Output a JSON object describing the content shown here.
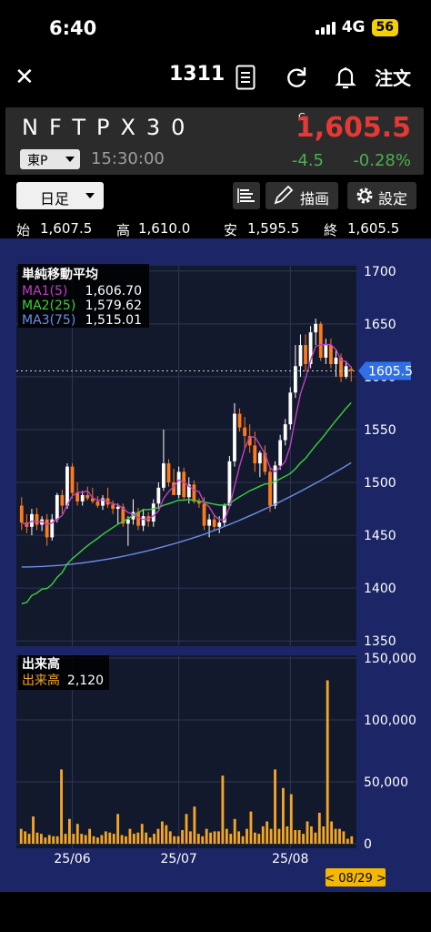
{
  "status_bar": {
    "time": "6:40",
    "network": "4G",
    "battery": "56"
  },
  "nav": {
    "stock_code": "1311",
    "order_label": "注文"
  },
  "quote": {
    "name": "NFTPX30",
    "realtime_marker": "C",
    "price": "1,605.5",
    "market": "東P",
    "time": "15:30:00",
    "change": "-4.5",
    "change_pct": "-0.28%"
  },
  "toolbar": {
    "period": "日足",
    "draw_label": "描画",
    "settings_label": "設定"
  },
  "ohlc": {
    "open_label": "始",
    "open": "1,607.5",
    "high_label": "高",
    "high": "1,610.0",
    "low_label": "安",
    "low": "1,595.5",
    "close_label": "終",
    "close": "1,605.5"
  },
  "colors": {
    "chart_bg": "#1c2565",
    "plot_bg": "#13192d",
    "up": "#ffffff",
    "down": "#ff7a1a",
    "ma1": "#c040c0",
    "ma2": "#3cd03c",
    "ma3": "#6c8ee6",
    "price_tag": "#2f6fe8",
    "volume": "#f5a623",
    "price_red": "#e53935",
    "change_green": "#4caf50"
  },
  "chart_data": {
    "type": "candlestick",
    "price_axis": {
      "ticks": [
        "1700",
        "1650",
        "1600",
        "1550",
        "1500",
        "1450",
        "1400",
        "1350"
      ],
      "min": 1345,
      "max": 1705
    },
    "volume_axis": {
      "ticks": [
        "150,000",
        "100,000",
        "50,000",
        "0"
      ],
      "max": 150000
    },
    "x_ticks": [
      "25/06",
      "25/07",
      "25/08"
    ],
    "x_tick_index": [
      10,
      31,
      53
    ],
    "last_price_tag": "1605.5",
    "date_tag": "< 08/29 >",
    "ma_legend": {
      "title": "単純移動平均",
      "items": [
        {
          "name": "MA1(5)",
          "value": "1,606.70"
        },
        {
          "name": "MA2(25)",
          "value": "1,579.62"
        },
        {
          "name": "MA3(75)",
          "value": "1,515.01"
        }
      ]
    },
    "volume_legend": {
      "title": "出来高",
      "name": "出来高",
      "value": "2,120"
    },
    "candles": [
      [
        1478,
        1486,
        1455,
        1462
      ],
      [
        1462,
        1470,
        1452,
        1458
      ],
      [
        1458,
        1475,
        1450,
        1470
      ],
      [
        1470,
        1476,
        1455,
        1460
      ],
      [
        1460,
        1468,
        1454,
        1465
      ],
      [
        1465,
        1470,
        1440,
        1448
      ],
      [
        1448,
        1470,
        1445,
        1465
      ],
      [
        1465,
        1490,
        1462,
        1488
      ],
      [
        1488,
        1493,
        1470,
        1478
      ],
      [
        1478,
        1518,
        1475,
        1515
      ],
      [
        1515,
        1518,
        1485,
        1490
      ],
      [
        1490,
        1500,
        1478,
        1482
      ],
      [
        1482,
        1492,
        1478,
        1488
      ],
      [
        1488,
        1496,
        1483,
        1485
      ],
      [
        1485,
        1495,
        1480,
        1482
      ],
      [
        1482,
        1487,
        1476,
        1478
      ],
      [
        1478,
        1488,
        1474,
        1485
      ],
      [
        1485,
        1495,
        1476,
        1479
      ],
      [
        1479,
        1483,
        1470,
        1475
      ],
      [
        1475,
        1480,
        1460,
        1477
      ],
      [
        1477,
        1480,
        1458,
        1461
      ],
      [
        1461,
        1468,
        1440,
        1465
      ],
      [
        1465,
        1484,
        1460,
        1472
      ],
      [
        1472,
        1476,
        1455,
        1459
      ],
      [
        1459,
        1475,
        1454,
        1468
      ],
      [
        1468,
        1472,
        1458,
        1463
      ],
      [
        1463,
        1484,
        1458,
        1480
      ],
      [
        1480,
        1500,
        1475,
        1495
      ],
      [
        1495,
        1550,
        1492,
        1518
      ],
      [
        1518,
        1522,
        1496,
        1500
      ],
      [
        1500,
        1513,
        1490,
        1488
      ],
      [
        1488,
        1515,
        1485,
        1510
      ],
      [
        1510,
        1514,
        1484,
        1486
      ],
      [
        1486,
        1505,
        1480,
        1498
      ],
      [
        1498,
        1502,
        1480,
        1482
      ],
      [
        1482,
        1485,
        1476,
        1480
      ],
      [
        1480,
        1486,
        1455,
        1459
      ],
      [
        1459,
        1470,
        1448,
        1465
      ],
      [
        1465,
        1470,
        1455,
        1458
      ],
      [
        1458,
        1468,
        1452,
        1462
      ],
      [
        1462,
        1480,
        1458,
        1478
      ],
      [
        1478,
        1525,
        1476,
        1520
      ],
      [
        1520,
        1575,
        1515,
        1565
      ],
      [
        1565,
        1570,
        1548,
        1552
      ],
      [
        1552,
        1562,
        1532,
        1544
      ],
      [
        1544,
        1555,
        1528,
        1535
      ],
      [
        1535,
        1548,
        1510,
        1518
      ],
      [
        1518,
        1530,
        1505,
        1528
      ],
      [
        1528,
        1535,
        1507,
        1510
      ],
      [
        1510,
        1515,
        1472,
        1478
      ],
      [
        1478,
        1520,
        1475,
        1516
      ],
      [
        1516,
        1545,
        1512,
        1540
      ],
      [
        1540,
        1560,
        1535,
        1555
      ],
      [
        1555,
        1590,
        1550,
        1585
      ],
      [
        1585,
        1630,
        1580,
        1610
      ],
      [
        1610,
        1640,
        1600,
        1630
      ],
      [
        1630,
        1640,
        1605,
        1612
      ],
      [
        1612,
        1648,
        1608,
        1642
      ],
      [
        1642,
        1655,
        1630,
        1650
      ],
      [
        1650,
        1652,
        1615,
        1618
      ],
      [
        1618,
        1636,
        1612,
        1630
      ],
      [
        1630,
        1636,
        1608,
        1612
      ],
      [
        1612,
        1625,
        1600,
        1618
      ],
      [
        1618,
        1622,
        1595,
        1600
      ],
      [
        1600,
        1615,
        1598,
        1610
      ],
      [
        1607.5,
        1610,
        1595.5,
        1605.5
      ]
    ],
    "volumes": [
      12000,
      10000,
      8000,
      22000,
      9000,
      8000,
      5000,
      7000,
      6000,
      6000,
      60000,
      8000,
      20000,
      8000,
      16000,
      8000,
      7000,
      12000,
      6000,
      5000,
      7000,
      10000,
      9000,
      8000,
      24000,
      7000,
      6000,
      12000,
      8000,
      9000,
      16000,
      9000,
      5000,
      8000,
      12000,
      18000,
      15000,
      10000,
      6000,
      6000,
      11000,
      24000,
      10000,
      30000,
      8000,
      6000,
      12000,
      9000,
      10000,
      10000,
      55000,
      12000,
      8000,
      20000,
      10000,
      6000,
      12000,
      26000,
      9000,
      8000,
      14000,
      18000,
      12000,
      60000,
      12000,
      45000,
      14000,
      40000,
      11000,
      11000,
      8000,
      18000,
      14000,
      9000,
      25000,
      14000,
      132000,
      18000,
      12000,
      12000,
      10000,
      4000,
      6000
    ]
  }
}
